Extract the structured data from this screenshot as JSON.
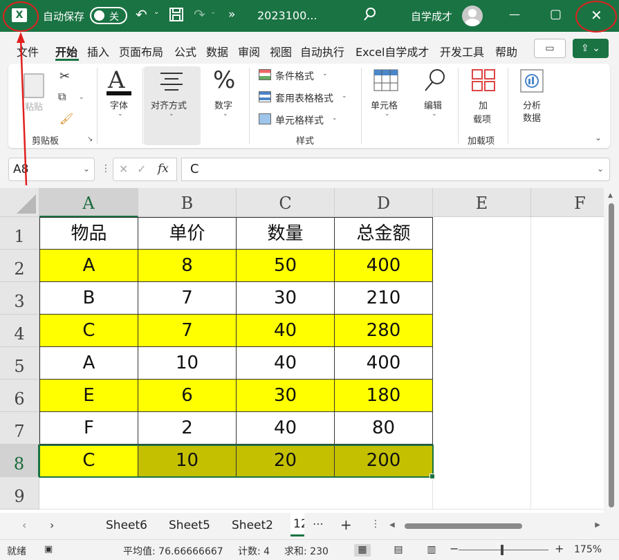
{
  "titlebar": {
    "app_icon": "excel-logo",
    "autosave_label": "自动保存",
    "autosave_state": "关",
    "more": "»",
    "filename": "2023100...",
    "user_name": "自学成才",
    "undo_icon": "undo-icon",
    "save_icon": "save-icon",
    "redo_icon": "redo-icon",
    "search_icon": "search-icon",
    "minimize": "—",
    "maximize": "▢",
    "close": "✕",
    "bg_color": "#1a7343"
  },
  "tabs": [
    "文件",
    "开始",
    "插入",
    "页面布局",
    "公式",
    "数据",
    "审阅",
    "视图",
    "自动执行",
    "Excel自学成才",
    "开发工具",
    "帮助"
  ],
  "active_tab": "开始",
  "ribbon": {
    "clipboard": {
      "paste": "粘贴",
      "group": "剪贴板"
    },
    "font": "字体",
    "align": "对齐方式",
    "number": "数字",
    "styles": {
      "conditional": "条件格式",
      "table": "套用表格格式",
      "cell_style": "单元格样式",
      "group": "样式"
    },
    "cells": "单元格",
    "editing": "编辑",
    "addins": {
      "label1": "加",
      "label2": "载项",
      "group": "加载项"
    },
    "analyze": {
      "label1": "分析",
      "label2": "数据"
    }
  },
  "formula_bar": {
    "name_box": "A8",
    "fx": "fx",
    "value": "C"
  },
  "grid": {
    "columns": [
      "A",
      "B",
      "C",
      "D",
      "E",
      "F"
    ],
    "rows": [
      "1",
      "2",
      "3",
      "4",
      "5",
      "6",
      "7",
      "8",
      "9"
    ],
    "cells": [
      [
        "物品",
        "单价",
        "数量",
        "总金额"
      ],
      [
        "A",
        "8",
        "50",
        "400"
      ],
      [
        "B",
        "7",
        "30",
        "210"
      ],
      [
        "C",
        "7",
        "40",
        "280"
      ],
      [
        "A",
        "10",
        "40",
        "400"
      ],
      [
        "E",
        "6",
        "30",
        "180"
      ],
      [
        "F",
        "2",
        "40",
        "80"
      ],
      [
        "C",
        "10",
        "20",
        "200"
      ]
    ],
    "highlight_color": "#ffff00",
    "selection_fill": "#c4c000"
  },
  "sheets": {
    "tabs": [
      "Sheet6",
      "Sheet5",
      "Sheet2",
      "12"
    ],
    "active": "12"
  },
  "status": {
    "ready": "就绪",
    "average": "平均值: 76.66666667",
    "count": "计数: 4",
    "sum": "求和: 230",
    "zoom": "175%",
    "zoom_minus": "−",
    "zoom_plus": "+"
  }
}
